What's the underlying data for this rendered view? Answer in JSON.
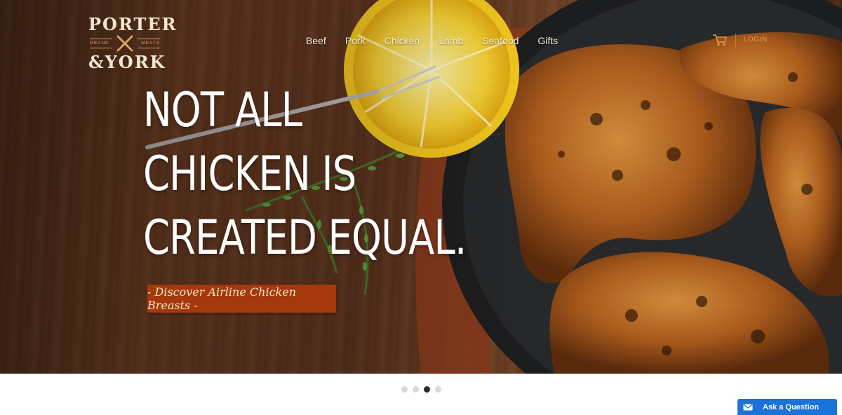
{
  "logo": {
    "top": "PORTER",
    "bottom": "&YORK",
    "brand": "BRAND",
    "meats": "MEATS"
  },
  "nav": {
    "items": [
      "Beef",
      "Pork",
      "Chicken",
      "Lamb",
      "Seafood",
      "Gifts"
    ],
    "login": "LOGIN",
    "cart_icon": "cart-icon"
  },
  "hero": {
    "headline_lines": [
      "NOT ALL",
      "CHICKEN IS",
      "CREATED EQUAL."
    ],
    "cta_label": "- Discover Airline Chicken Breasts -"
  },
  "slider": {
    "dot_count": 4,
    "active_index": 2
  },
  "chat": {
    "label": "Ask a Question",
    "icon": "envelope-icon"
  },
  "colors": {
    "cta_bg": "#a3390c",
    "login": "#e79c50",
    "ask_bg": "#1a73d9"
  }
}
